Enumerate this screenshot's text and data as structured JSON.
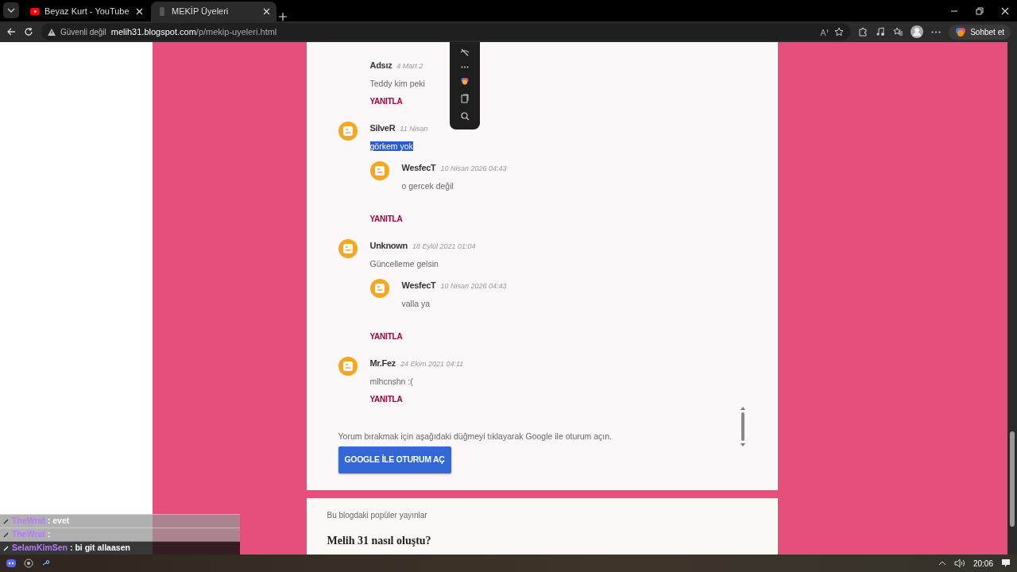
{
  "browser": {
    "tabs": [
      {
        "title": "Beyaz Kurt - YouTube",
        "selected": false
      },
      {
        "title": "MEKİP Üyeleri",
        "selected": true
      }
    ],
    "security": "Güvenli değil",
    "url_host": "melih31.blogspot.com",
    "url_path": "/p/mekip-uyeleri.html",
    "copilot": "Sohbet et"
  },
  "comments": [
    {
      "author": "Adsız",
      "date": "4 Mart 2",
      "text": "Teddy kim peki",
      "avatar": false,
      "reply": "YANITLA",
      "selected_text": false
    },
    {
      "author": "SilveR",
      "date": "11 Nisan",
      "text": "görkem yok",
      "avatar": true,
      "selected_text": true,
      "replies": [
        {
          "author": "WesfecT",
          "date": "10 Nisan 2026 04:43",
          "text": "o gercek değil",
          "avatar": true
        }
      ],
      "reply": "YANITLA"
    },
    {
      "author": "Unknown",
      "date": "18 Eylül 2021 01:04",
      "text": "Güncelleme gelsin",
      "avatar": true,
      "selected_text": false,
      "replies": [
        {
          "author": "WesfecT",
          "date": "10 Nisan 2026 04:43",
          "text": "valla ya",
          "avatar": true
        }
      ],
      "reply": "YANITLA"
    },
    {
      "author": "Mr.Fez",
      "date": "24 Ekim 2021 04:11",
      "text": "mlhcnshn :(",
      "avatar": true,
      "selected_text": false,
      "reply": "YANITLA"
    }
  ],
  "signin": {
    "text": "Yorum bırakmak için aşağıdaki düğmeyi tıklayarak Google ile oturum açın.",
    "button": "GOOGLE İLE OTURUM AÇ"
  },
  "popular": {
    "heading": "Bu blogdaki popüler yayınlar",
    "post_title": "Melih 31 nasıl oluştu?"
  },
  "chat": [
    {
      "user": "TheWrat",
      "message": ": evet"
    },
    {
      "user": "TheWrat",
      "message": ":"
    },
    {
      "user": "SelamKimSen",
      "message": ": bi git allaasen"
    }
  ],
  "taskbar": {
    "time": "20:06"
  }
}
